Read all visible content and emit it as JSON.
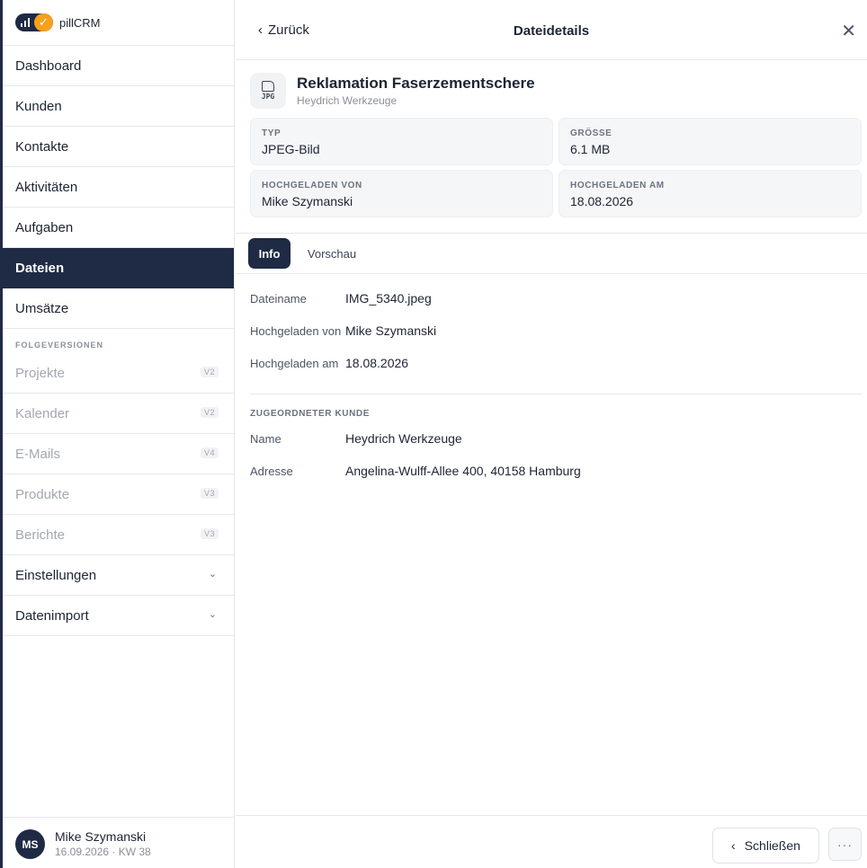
{
  "app": {
    "logo_text": "pillCRM"
  },
  "sidebar": {
    "items": [
      {
        "label": "Dashboard"
      },
      {
        "label": "Kunden"
      },
      {
        "label": "Kontakte"
      },
      {
        "label": "Aktivitäten"
      },
      {
        "label": "Aufgaben"
      },
      {
        "label": "Dateien",
        "active": true
      },
      {
        "label": "Umsätze"
      }
    ],
    "section_label": "FOLGEVERSIONEN",
    "future_items": [
      {
        "label": "Projekte",
        "badge": "V2"
      },
      {
        "label": "Kalender",
        "badge": "V2"
      },
      {
        "label": "E-Mails",
        "badge": "V4"
      },
      {
        "label": "Produkte",
        "badge": "V3"
      },
      {
        "label": "Berichte",
        "badge": "V3"
      }
    ],
    "expandable": [
      {
        "label": "Einstellungen",
        "icon": "chevron-down-icon"
      },
      {
        "label": "Datenimport",
        "icon": "chevron-down-icon"
      }
    ],
    "user": {
      "initials": "MS",
      "name": "Mike Szymanski",
      "date": "16.09.2026 · KW 38"
    }
  },
  "panel": {
    "back_label": "Zurück",
    "title": "Dateidetails",
    "file": {
      "ext": "JPG",
      "name": "Reklamation Faserzementschere",
      "customer": "Heydrich Werkzeuge"
    },
    "meta": [
      {
        "label": "TYP",
        "value": "JPEG-Bild"
      },
      {
        "label": "GRÖSSE",
        "value": "6.1 MB"
      },
      {
        "label": "HOCHGELADEN VON",
        "value": "Mike Szymanski"
      },
      {
        "label": "HOCHGELADEN AM",
        "value": "18.08.2026"
      }
    ],
    "tabs": [
      {
        "label": "Info",
        "active": true
      },
      {
        "label": "Vorschau"
      }
    ],
    "info": [
      {
        "label": "Dateiname",
        "value": "IMG_5340.jpeg"
      },
      {
        "label": "Hochgeladen von",
        "value": "Mike Szymanski"
      },
      {
        "label": "Hochgeladen am",
        "value": "18.08.2026"
      }
    ],
    "customer_section": {
      "title": "ZUGEORDNETER KUNDE",
      "rows": [
        {
          "label": "Name",
          "value": "Heydrich Werkzeuge"
        },
        {
          "label": "Adresse",
          "value": "Angelina-Wulff-Allee 400, 40158 Hamburg"
        }
      ]
    },
    "footer": {
      "close_label": "Schließen",
      "more_label": "···"
    }
  },
  "colors": {
    "primary": "#1f2a44",
    "accent": "#f5a11b"
  }
}
